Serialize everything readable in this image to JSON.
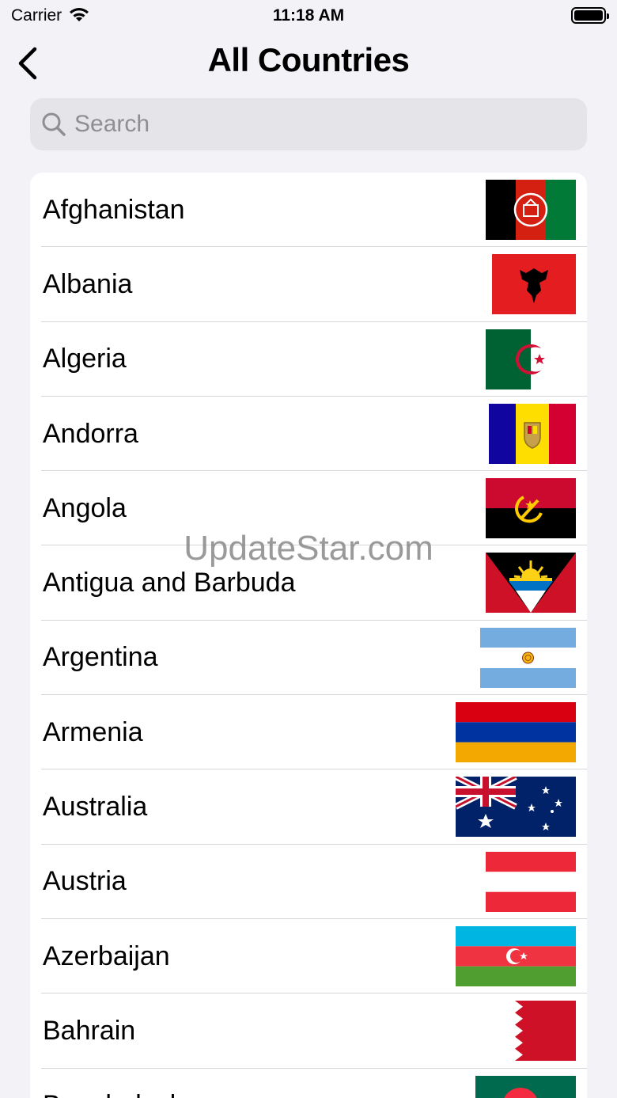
{
  "status_bar": {
    "carrier": "Carrier",
    "time": "11:18 AM"
  },
  "nav": {
    "title": "All Countries"
  },
  "search": {
    "placeholder": "Search",
    "value": ""
  },
  "countries": [
    {
      "name": "Afghanistan",
      "flag": "flag-af"
    },
    {
      "name": "Albania",
      "flag": "flag-al"
    },
    {
      "name": "Algeria",
      "flag": "flag-dz"
    },
    {
      "name": "Andorra",
      "flag": "flag-ad"
    },
    {
      "name": "Angola",
      "flag": "flag-ao"
    },
    {
      "name": "Antigua and Barbuda",
      "flag": "flag-ag"
    },
    {
      "name": "Argentina",
      "flag": "flag-ar"
    },
    {
      "name": "Armenia",
      "flag": "flag-am"
    },
    {
      "name": "Australia",
      "flag": "flag-au"
    },
    {
      "name": "Austria",
      "flag": "flag-at"
    },
    {
      "name": "Azerbaijan",
      "flag": "flag-az"
    },
    {
      "name": "Bahrain",
      "flag": "flag-bh"
    },
    {
      "name": "Bangladesh",
      "flag": "flag-bd"
    }
  ],
  "watermark": "UpdateStar.com"
}
